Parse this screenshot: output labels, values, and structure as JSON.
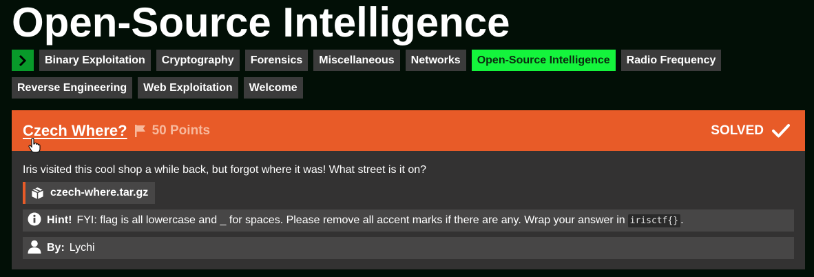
{
  "page": {
    "title": "Open-Source Intelligence"
  },
  "categories": {
    "row1": [
      "Binary Exploitation",
      "Cryptography",
      "Forensics",
      "Miscellaneous",
      "Networks",
      "Open-Source Intelligence",
      "Radio Frequency"
    ],
    "row2": [
      "Reverse Engineering",
      "Web Exploitation",
      "Welcome"
    ],
    "active": "Open-Source Intelligence"
  },
  "challenge": {
    "name": "Czech Where?",
    "points": "50 Points",
    "status": "SOLVED",
    "description": "Iris visited this cool shop a while back, but forgot where it was! What street is it on?",
    "file": "czech-where.tar.gz",
    "hint_label": "Hint!",
    "hint_text": "FYI: flag is all lowercase and _ for spaces. Please remove all accent marks if there are any. Wrap your answer in",
    "hint_code": "irisctf{}",
    "hint_end": ".",
    "by_label": "By:",
    "author": "Lychi"
  },
  "colors": {
    "background": "#020f06",
    "accent": "#e85b28",
    "active_category": "#14f43c",
    "toggle": "#089a2a",
    "card": "#333232"
  },
  "icons": {
    "toggle": "chevron-right-icon",
    "flag": "flag-icon",
    "solved": "check-icon",
    "file": "package-icon",
    "hint": "info-icon",
    "author": "user-icon",
    "cursor": "hand-pointer-icon"
  }
}
